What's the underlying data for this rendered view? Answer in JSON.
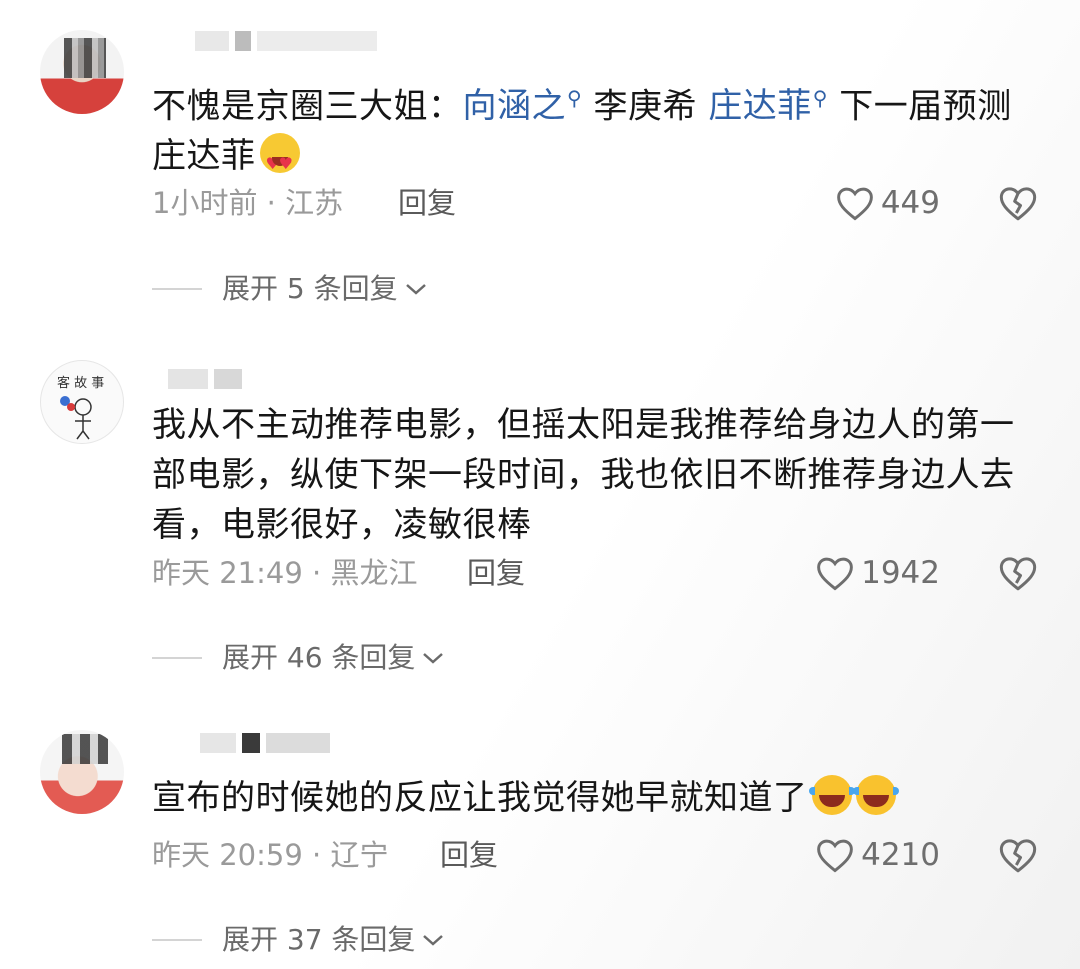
{
  "comments": [
    {
      "text_prefix": "不愧是京圈三大姐：",
      "tag1": "向涵之",
      "middle": " 李庚希 ",
      "tag2": "庄达菲",
      "text_suffix": " 下一届预测庄达菲",
      "emoji": "heart-eyes-emoji",
      "time_location": "1小时前 · 江苏",
      "reply_label": "回复",
      "likes": "449",
      "expand_label": "展开 5 条回复"
    },
    {
      "text": "我从不主动推荐电影，但摇太阳是我推荐给身边人的第一部电影，纵使下架一段时间，我也依旧不断推荐身边人去看，电影很好，凌敏很棒",
      "time_location": "昨天 21:49 · 黑龙江",
      "reply_label": "回复",
      "likes": "1942",
      "expand_label": "展开 46 条回复"
    },
    {
      "text": "宣布的时候她的反应让我觉得她早就知道了",
      "emoji": "laughing-crying-emoji",
      "time_location": "昨天 20:59 · 辽宁",
      "reply_label": "回复",
      "likes": "4210",
      "expand_label": "展开 37 条回复"
    }
  ],
  "icons": {
    "like": "heart-outline-icon",
    "dislike": "broken-heart-icon",
    "search_tag": "search-icon",
    "expand": "chevron-down-icon"
  },
  "colors": {
    "tag": "#3061a7",
    "meta": "#9a9a9a",
    "text": "#161616"
  }
}
